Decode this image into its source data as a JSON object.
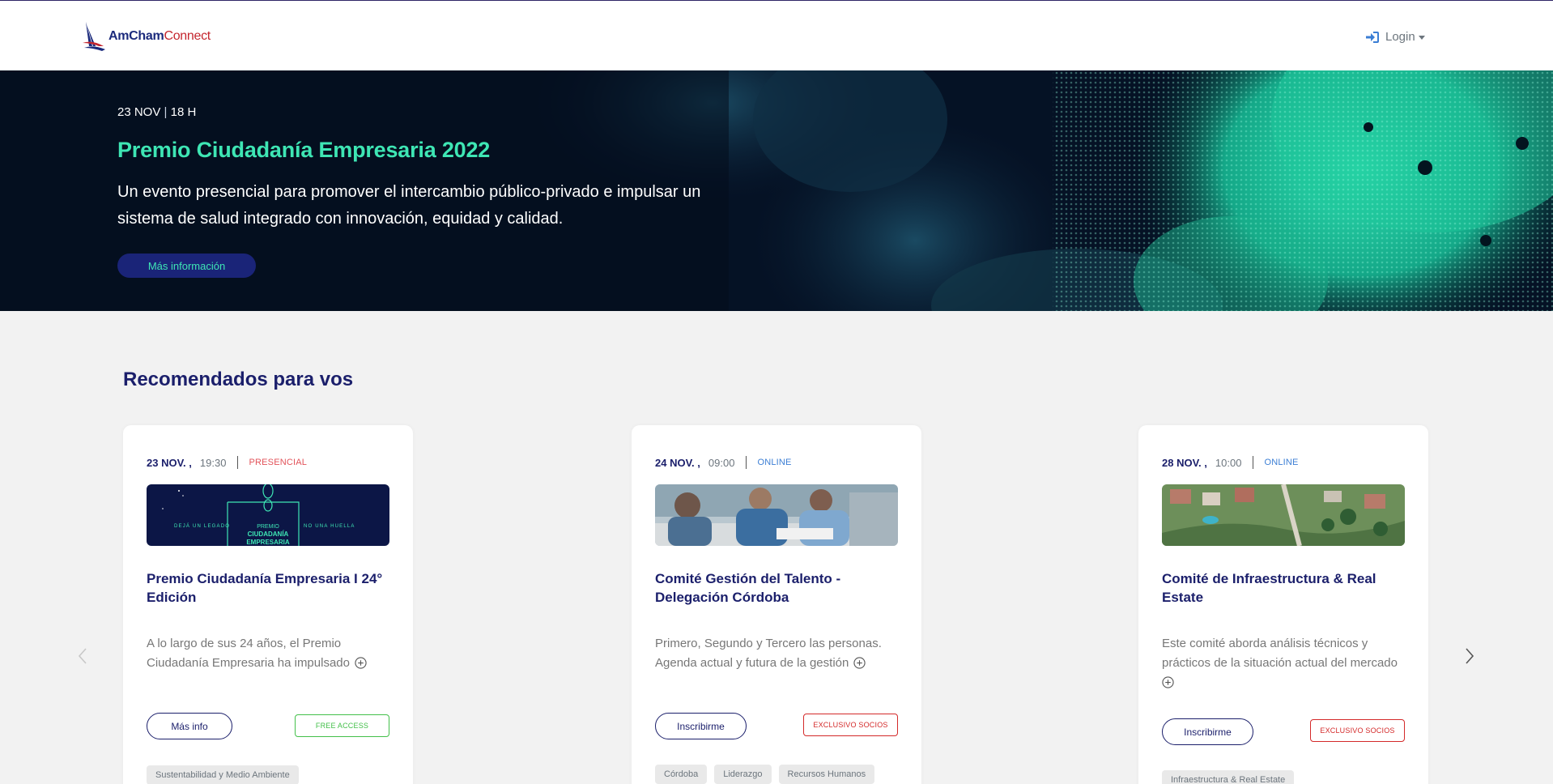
{
  "header": {
    "logo_part1": "AmCham",
    "logo_part2": "Connect",
    "login_label": "Login"
  },
  "hero": {
    "date": "23 NOV",
    "time": "18 H",
    "title": "Premio Ciudadanía Empresaria 2022",
    "description": "Un evento presencial para promover el intercambio público-privado e impulsar un sistema de salud integrado con innovación, equidad y calidad.",
    "button_label": "Más información"
  },
  "section": {
    "title_strong": "Recomendados",
    "title_rest": "para vos"
  },
  "cards": [
    {
      "date": "23 NOV. ,",
      "time": "19:30",
      "mode": "PRESENCIAL",
      "image_text": {
        "left": "DEJÁ UN LEGADO",
        "right": "NO UNA HUELLA",
        "premio": "PREMIO",
        "ciudadania": "CIUDADANÍA",
        "empresaria": "EMPRESARIA"
      },
      "title": "Premio Ciudadanía Empresaria I 24° Edición",
      "description": "A lo largo de sus 24 años, el Premio Ciudadanía Empresaria ha impulsado",
      "button_label": "Más info",
      "badge": "FREE ACCESS",
      "tags": [
        "Sustentabilidad y Medio Ambiente"
      ]
    },
    {
      "date": "24 NOV. ,",
      "time": "09:00",
      "mode": "ONLINE",
      "title": "Comité Gestión del Talento - Delegación Córdoba",
      "description": "Primero, Segundo y Tercero las personas. Agenda actual y futura de la gestión",
      "button_label": "Inscribirme",
      "badge": "EXCLUSIVO SOCIOS",
      "tags": [
        "Córdoba",
        "Liderazgo",
        "Recursos Humanos"
      ]
    },
    {
      "date": "28 NOV. ,",
      "time": "10:00",
      "mode": "ONLINE",
      "title": "Comité de Infraestructura & Real Estate",
      "description": "Este comité aborda análisis técnicos y prácticos de la situación actual del mercado",
      "button_label": "Inscribirme",
      "badge": "EXCLUSIVO SOCIOS",
      "tags": [
        "Infraestructura & Real Estate"
      ]
    }
  ],
  "colors": {
    "brand_navy": "#1b1f6b",
    "brand_red": "#c4262e",
    "accent_teal": "#3ee6b4",
    "online_blue": "#3b7ed4",
    "presencial_red": "#e2535a",
    "free_green": "#43c04a"
  },
  "icons": {
    "login": "sign-in-icon",
    "prev": "chevron-left-icon",
    "next": "chevron-right-icon",
    "expand": "plus-circle-icon"
  }
}
